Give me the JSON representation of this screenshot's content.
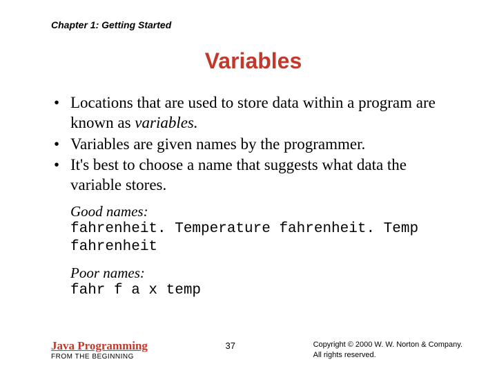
{
  "chapter": "Chapter 1: Getting Started",
  "title": "Variables",
  "bullets": {
    "b1a": "Locations that are used to store data within a program are known as ",
    "b1b": "variables.",
    "b2": "Variables are given names by the programmer.",
    "b3": "It's best to choose a name that suggests what data the variable stores."
  },
  "good": {
    "heading": "Good names:",
    "line1": "fahrenheit. Temperature fahrenheit. Temp",
    "line2": "fahrenheit"
  },
  "poor": {
    "heading": "Poor names:",
    "line1": "fahr f a x temp"
  },
  "footer": {
    "bookMain": "Java Programming",
    "bookSub": "FROM THE BEGINNING",
    "page": "37",
    "copy1": "Copyright © 2000 W. W. Norton & Company.",
    "copy2": "All rights reserved."
  }
}
